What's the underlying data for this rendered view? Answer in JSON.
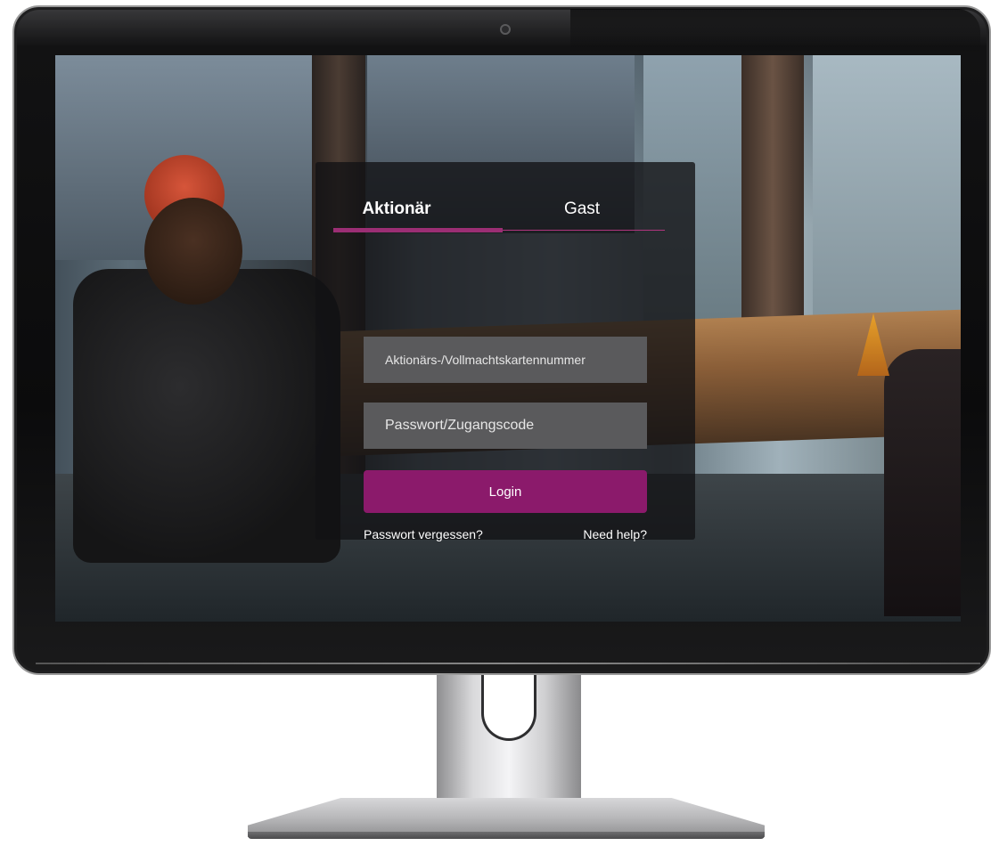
{
  "tabs": {
    "shareholder_label": "Aktionär",
    "guest_label": "Gast"
  },
  "form": {
    "card_number_placeholder": "Aktionärs-/Vollmachtskartennummer",
    "password_placeholder": "Passwort/Zugangscode",
    "login_label": "Login",
    "forgot_password_label": "Passwort vergessen?",
    "need_help_label": "Need help?"
  },
  "colors": {
    "accent": "#8b1a6b",
    "tab_indicator": "#9b2e74",
    "input_background": "#5a5a5c",
    "card_background": "rgba(18,18,20,0.78)"
  }
}
